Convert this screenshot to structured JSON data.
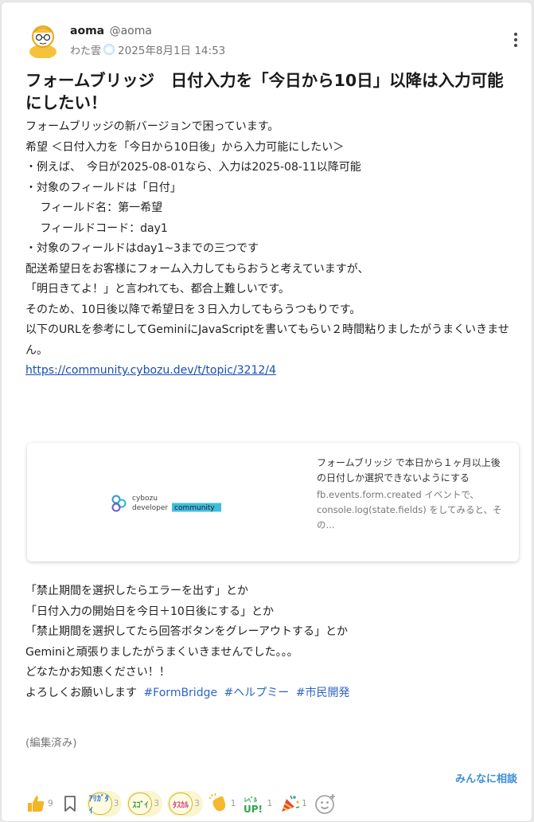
{
  "author": {
    "name": "aoma",
    "handle": "@aoma",
    "role": "わた雲",
    "date": "2025年8月1日 14:53"
  },
  "post": {
    "title": "フォームブリッジ　日付入力を「今日から10日」以降は入力可能にしたい！",
    "paragraphs": [
      "フォームブリッジの新バージョンで困っています。",
      "",
      "希望 ＜日付入力を「今日から10日後」から入力可能にしたい＞",
      "・例えば、　今日が2025-08-01なら、入力は2025-08-11以降可能",
      "・対象のフィールドは「日付」",
      "　 フィールド名：第一希望",
      "　 フィールドコード：day1",
      "・対象のフィールドはday1~3までの三つです",
      "",
      "配送希望日をお客様にフォーム入力してもらおうと考えていますが、",
      "「明日きてよ！」と言われても、都合上難しいです。",
      "そのため、10日後以降で希望日を３日入力してもらうつもりです。",
      "",
      "以下のURLを参考にしてGeminiにJavaScriptを書いてもらい２時間粘りましたがうまくいきません。"
    ],
    "link": "https://community.cybozu.dev/t/topic/3212/4",
    "paragraphs2": [
      "「禁止期間を選択したらエラーを出す」とか",
      "「日付入力の開始日を今日＋10日後にする」とか",
      "「禁止期間を選択してたら回答ボタンをグレーアウトする」とか",
      "Geminiと頑張りましたがうまくいきませんでした。。。",
      "",
      "どなたかお知恵ください！！"
    ],
    "closing": "よろしくお願いします",
    "tags": [
      "#FormBridge",
      "#ヘルプミー",
      "#市民開発"
    ],
    "edited": "(編集済み)"
  },
  "preview": {
    "logo_text_top": "cybozu",
    "logo_text_bottom": "developer",
    "logo_badge": "community",
    "title": "フォームブリッジ で本日から１ヶ月以上後の日付しか選択できないようにする",
    "description": "fb.events.form.created イベントで、console.log(state.fields) をしてみると、その..."
  },
  "footer": {
    "consult_label": "みんなに相談",
    "like_count": "9",
    "stamps": [
      {
        "icon": "arigatai-stamp-icon",
        "text": "ｱﾘｶﾞﾀｲ",
        "count": "3"
      },
      {
        "icon": "sugoi-stamp-icon",
        "text": "ｽｺﾞｲ",
        "count": "3"
      },
      {
        "icon": "tasukaru-stamp-icon",
        "text": "ﾀｽｶﾙ",
        "count": "3"
      }
    ],
    "clap_count": "1",
    "levelup_count": "1",
    "party_count": "1"
  },
  "colors": {
    "link": "#1a4fb0",
    "tag": "#2e63c8",
    "consult": "#3c8ed8",
    "stamp_bg": "#fbf5d0"
  }
}
